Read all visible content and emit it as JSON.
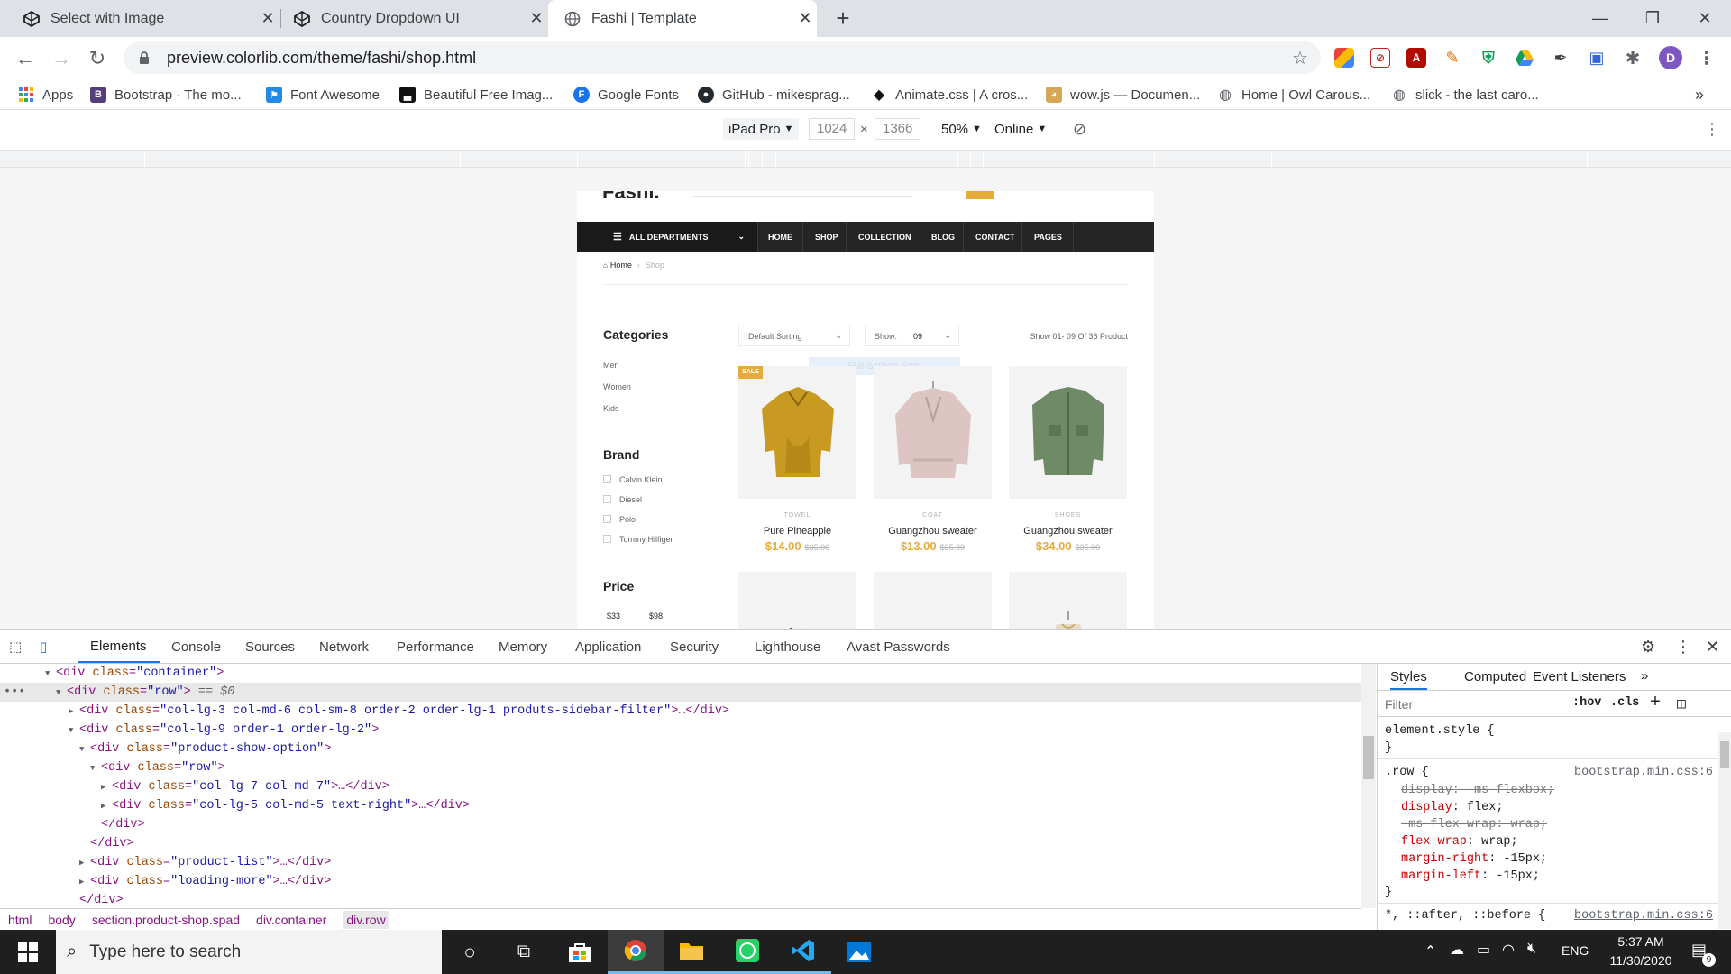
{
  "browser": {
    "tabs": [
      {
        "title": "Select with Image",
        "icon": "codepen-icon",
        "active": false
      },
      {
        "title": "Country Dropdown UI",
        "icon": "codepen-icon",
        "active": false
      },
      {
        "title": "Fashi | Template",
        "icon": "globe-icon",
        "active": true
      }
    ],
    "new_tab_glyph": "+",
    "url": "preview.colorlib.com/theme/fashi/shop.html",
    "profile_initial": "D",
    "bookmarks": [
      {
        "label": "Apps",
        "icon": "apps-grid-icon"
      },
      {
        "label": "Bootstrap · The mo...",
        "icon": "bootstrap-icon"
      },
      {
        "label": "Font Awesome",
        "icon": "font-awesome-icon"
      },
      {
        "label": "Beautiful Free Imag...",
        "icon": "unsplash-icon"
      },
      {
        "label": "Google Fonts",
        "icon": "google-fonts-icon"
      },
      {
        "label": "GitHub - mikesprag...",
        "icon": "github-icon"
      },
      {
        "label": "Animate.css | A cros...",
        "icon": "animate-css-icon"
      },
      {
        "label": "wow.js — Documen...",
        "icon": "doge-icon"
      },
      {
        "label": "Home | Owl Carous...",
        "icon": "globe-icon"
      },
      {
        "label": "slick - the last caro...",
        "icon": "globe-icon"
      }
    ],
    "bookmarks_overflow": "»"
  },
  "device_toolbar": {
    "device": "iPad Pro",
    "width": "1024",
    "height": "1366",
    "times": "×",
    "zoom": "50%",
    "throttle": "Online"
  },
  "site": {
    "logo_partial": "Fashi.",
    "nav": {
      "departments": "ALL DEPARTMENTS",
      "links": [
        "HOME",
        "SHOP",
        "COLLECTION",
        "BLOG",
        "CONTACT",
        "PAGES"
      ]
    },
    "breadcrumb": {
      "home": "Home",
      "separator": "›",
      "current": "Shop"
    },
    "sidebar": {
      "categories_title": "Categories",
      "categories": [
        "Men",
        "Women",
        "Kids"
      ],
      "brand_title": "Brand",
      "brands": [
        "Calvin Klein",
        "Diesel",
        "Polo",
        "Tommy Hilfiger"
      ],
      "price_title": "Price",
      "price_min": "$33",
      "price_max": "$98"
    },
    "toolbar": {
      "sorting": "Default Sorting",
      "show_label": "Show:",
      "show_value": "09",
      "result_text": "Show 01- 09 Of 36 Product"
    },
    "overlay_text": "Full Screen Snip",
    "products": [
      {
        "category": "TOWEL",
        "name": "Pure Pineapple",
        "price": "$14.00",
        "old_price": "$35.00",
        "badge": "SALE",
        "color": "#c99a22"
      },
      {
        "category": "COAT",
        "name": "Guangzhou sweater",
        "price": "$13.00",
        "old_price": "$35.00",
        "badge": "",
        "color": "#dcc5c2"
      },
      {
        "category": "SHOES",
        "name": "Guangzhou sweater",
        "price": "$34.00",
        "old_price": "$35.00",
        "badge": "",
        "color": "#6f8a66"
      }
    ],
    "products_row2_colors": [
      "#4a4a4a",
      "#f2c511",
      "#e8dcc8"
    ]
  },
  "devtools": {
    "tabs": [
      "Elements",
      "Console",
      "Sources",
      "Network",
      "Performance",
      "Memory",
      "Application",
      "Security",
      "Lighthouse",
      "Avast Passwords"
    ],
    "dom_lines": [
      {
        "arrow": "▼",
        "open": "<div",
        "attr": "class",
        "val": "\"container\"",
        "rest": ">"
      },
      {
        "arrow": "▼",
        "open": "<div",
        "attr": "class",
        "val": "\"row\"",
        "rest": "> == $0"
      },
      {
        "arrow": "▶",
        "open": "<div",
        "attr": "class",
        "val": "\"col-lg-3 col-md-6 col-sm-8 order-2 order-lg-1 produts-sidebar-filter\"",
        "rest": ">…</div>"
      },
      {
        "arrow": "▼",
        "open": "<div",
        "attr": "class",
        "val": "\"col-lg-9 order-1 order-lg-2\"",
        "rest": ">"
      },
      {
        "arrow": "▼",
        "open": "<div",
        "attr": "class",
        "val": "\"product-show-option\"",
        "rest": ">"
      },
      {
        "arrow": "▼",
        "open": "<div",
        "attr": "class",
        "val": "\"row\"",
        "rest": ">"
      },
      {
        "arrow": "▶",
        "open": "<div",
        "attr": "class",
        "val": "\"col-lg-7 col-md-7\"",
        "rest": ">…</div>"
      },
      {
        "arrow": "▶",
        "open": "<div",
        "attr": "class",
        "val": "\"col-lg-5 col-md-5 text-right\"",
        "rest": ">…</div>"
      },
      {
        "arrow": "",
        "open": "</div>",
        "attr": "",
        "val": "",
        "rest": ""
      },
      {
        "arrow": "",
        "open": "</div>",
        "attr": "",
        "val": "",
        "rest": ""
      },
      {
        "arrow": "▶",
        "open": "<div",
        "attr": "class",
        "val": "\"product-list\"",
        "rest": ">…</div>"
      },
      {
        "arrow": "▶",
        "open": "<div",
        "attr": "class",
        "val": "\"loading-more\"",
        "rest": ">…</div>"
      },
      {
        "arrow": "",
        "open": "</div>",
        "attr": "",
        "val": "",
        "rest": ""
      }
    ],
    "breadcrumbs": [
      "html",
      "body",
      "section.product-shop.spad",
      "div.container",
      "div.row"
    ],
    "styles_tabs": [
      "Styles",
      "Computed",
      "Event Listeners",
      "»"
    ],
    "filter_placeholder": "Filter",
    "hov": ":hov",
    "cls": ".cls",
    "element_style": "element.style {",
    "close_brace": "}",
    "rule_selector": ".row {",
    "rule_source": "bootstrap.min.css:6",
    "rule_props": [
      {
        "name": "display",
        "value": "-ms-flexbox;",
        "struck": true
      },
      {
        "name": "display",
        "value": "flex;",
        "struck": false
      },
      {
        "name": "-ms-flex-wrap",
        "value": "wrap;",
        "struck": true
      },
      {
        "name": "flex-wrap",
        "value": "wrap;",
        "struck": false
      },
      {
        "name": "margin-right",
        "value": "-15px;",
        "struck": false
      },
      {
        "name": "margin-left",
        "value": "-15px;",
        "struck": false
      }
    ],
    "next_selector": "*, ::after, ::before {",
    "next_source": "bootstrap.min.css:6"
  },
  "taskbar": {
    "search_placeholder": "Type here to search",
    "language": "ENG",
    "time": "5:37 AM",
    "date": "11/30/2020",
    "notifications": "9"
  }
}
